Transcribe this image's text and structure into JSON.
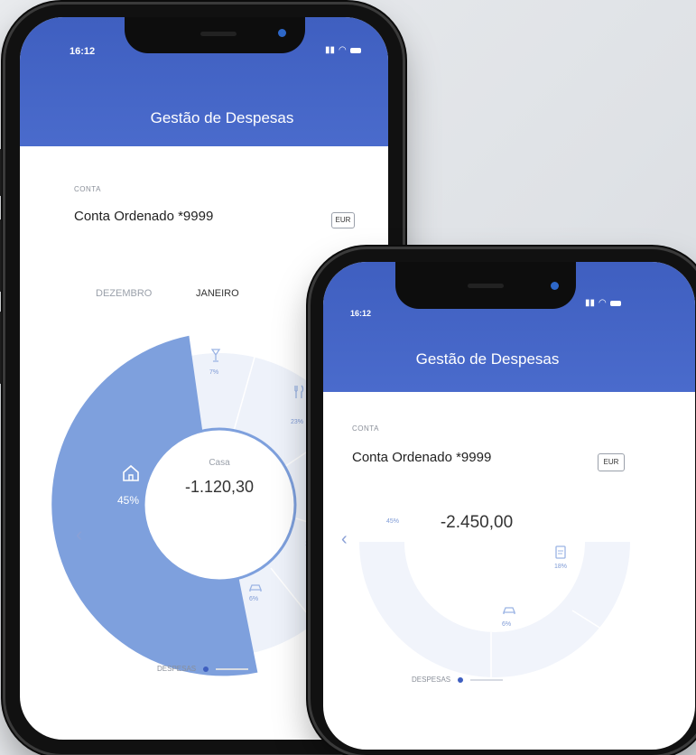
{
  "phone_left": {
    "status_time": "16:12",
    "app_title": "Gestão de Despesas",
    "account_label": "CONTA",
    "account_name": "Conta Ordenado *9999",
    "currency": "EUR",
    "month_prev": "DEZEMBRO",
    "month_current": "JANEIRO",
    "segments": [
      {
        "name": "Casa",
        "percent_label": "45%",
        "icon": "house-icon"
      },
      {
        "percent_label": "7%",
        "icon": "glass-icon"
      },
      {
        "percent_label": "23%",
        "icon": "fork-knife-icon"
      },
      {
        "percent_label": "18%",
        "icon": "document-icon"
      },
      {
        "percent_label": "6%",
        "icon": "car-icon"
      }
    ],
    "center_category": "Casa",
    "center_amount": "-1.120,30",
    "toggle_label": "DESPESAS"
  },
  "phone_right": {
    "status_time": "16:12",
    "app_title": "Gestão de Despesas",
    "account_label": "CONTA",
    "account_name": "Conta Ordenado *9999",
    "currency": "EUR",
    "segments": [
      {
        "percent_label": "45%"
      },
      {
        "percent_label": "18%",
        "icon": "document-icon"
      },
      {
        "percent_label": "6%",
        "icon": "car-icon"
      }
    ],
    "center_amount": "-2.450,00",
    "toggle_label": "DESPESAS"
  },
  "colors": {
    "header_blue": "#4464c5",
    "segment_active": "#7ea0dd",
    "segment_light": "#eef2fa"
  }
}
